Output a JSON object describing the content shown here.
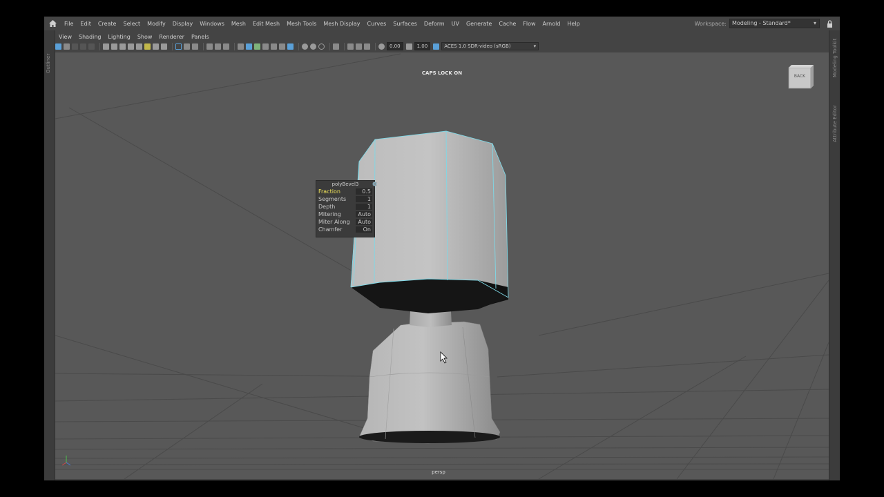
{
  "menubar": {
    "items": [
      "File",
      "Edit",
      "Create",
      "Select",
      "Modify",
      "Display",
      "Windows",
      "Mesh",
      "Edit Mesh",
      "Mesh Tools",
      "Mesh Display",
      "Curves",
      "Surfaces",
      "Deform",
      "UV",
      "Generate",
      "Cache",
      "Flow",
      "Arnold",
      "Help"
    ],
    "workspace_label": "Workspace:",
    "workspace_value": "Modeling - Standard*"
  },
  "side_panels": {
    "left": "Outliner",
    "right_top": "Modeling Toolkit",
    "right_bottom": "Attribute Editor"
  },
  "panel_menu": [
    "View",
    "Shading",
    "Lighting",
    "Show",
    "Renderer",
    "Panels"
  ],
  "toolbar": {
    "exposure": "0.00",
    "gamma": "1.00",
    "color_space": "ACES 1.0 SDR-video (sRGB)"
  },
  "viewport": {
    "hud_message": "CAPS LOCK ON",
    "camera": "persp",
    "viewcube_face": "BACK"
  },
  "bevel_panel": {
    "title": "polyBevel3",
    "rows": [
      {
        "label": "Fraction",
        "value": "0.5"
      },
      {
        "label": "Segments",
        "value": "1"
      },
      {
        "label": "Depth",
        "value": "1"
      },
      {
        "label": "Mitering",
        "value": "Auto"
      },
      {
        "label": "Miter Along",
        "value": "Auto"
      },
      {
        "label": "Chamfer",
        "value": "On"
      }
    ]
  },
  "colors": {
    "highlight": "#f0e35a",
    "selection_edge": "#7fd8e6",
    "viewport_bg": "#585858",
    "ui_bg": "#444444"
  }
}
